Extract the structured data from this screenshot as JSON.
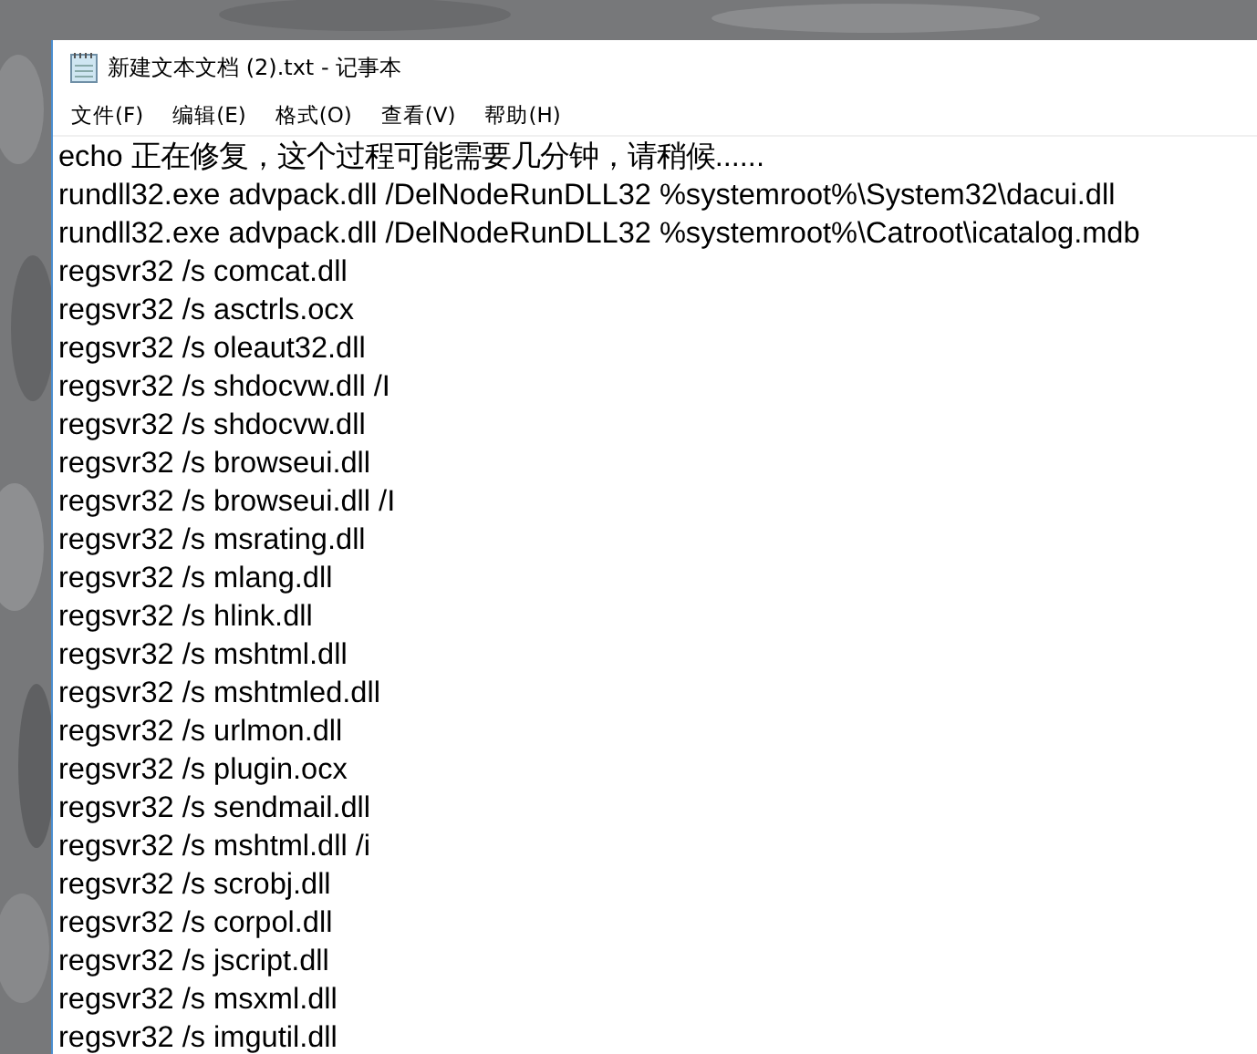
{
  "window": {
    "title": "新建文本文档 (2).txt - 记事本"
  },
  "menu": [
    "文件(F)",
    "编辑(E)",
    "格式(O)",
    "查看(V)",
    "帮助(H)"
  ],
  "lines": [
    "echo 正在修复，这个过程可能需要几分钟，请稍候......",
    "rundll32.exe advpack.dll /DelNodeRunDLL32 %systemroot%\\System32\\dacui.dll",
    "rundll32.exe advpack.dll /DelNodeRunDLL32 %systemroot%\\Catroot\\icatalog.mdb",
    "regsvr32 /s comcat.dll",
    "regsvr32 /s asctrls.ocx",
    "regsvr32 /s oleaut32.dll",
    "regsvr32 /s shdocvw.dll /I",
    "regsvr32 /s shdocvw.dll",
    "regsvr32 /s browseui.dll",
    "regsvr32 /s browseui.dll /I",
    "regsvr32 /s msrating.dll",
    "regsvr32 /s mlang.dll",
    "regsvr32 /s hlink.dll",
    "regsvr32 /s mshtml.dll",
    "regsvr32 /s mshtmled.dll",
    "regsvr32 /s urlmon.dll",
    "regsvr32 /s plugin.ocx",
    "regsvr32 /s sendmail.dll",
    "regsvr32 /s mshtml.dll /i",
    "regsvr32 /s scrobj.dll",
    "regsvr32 /s corpol.dll",
    "regsvr32 /s jscript.dll",
    "regsvr32 /s msxml.dll",
    "regsvr32 /s imgutil.dll"
  ]
}
